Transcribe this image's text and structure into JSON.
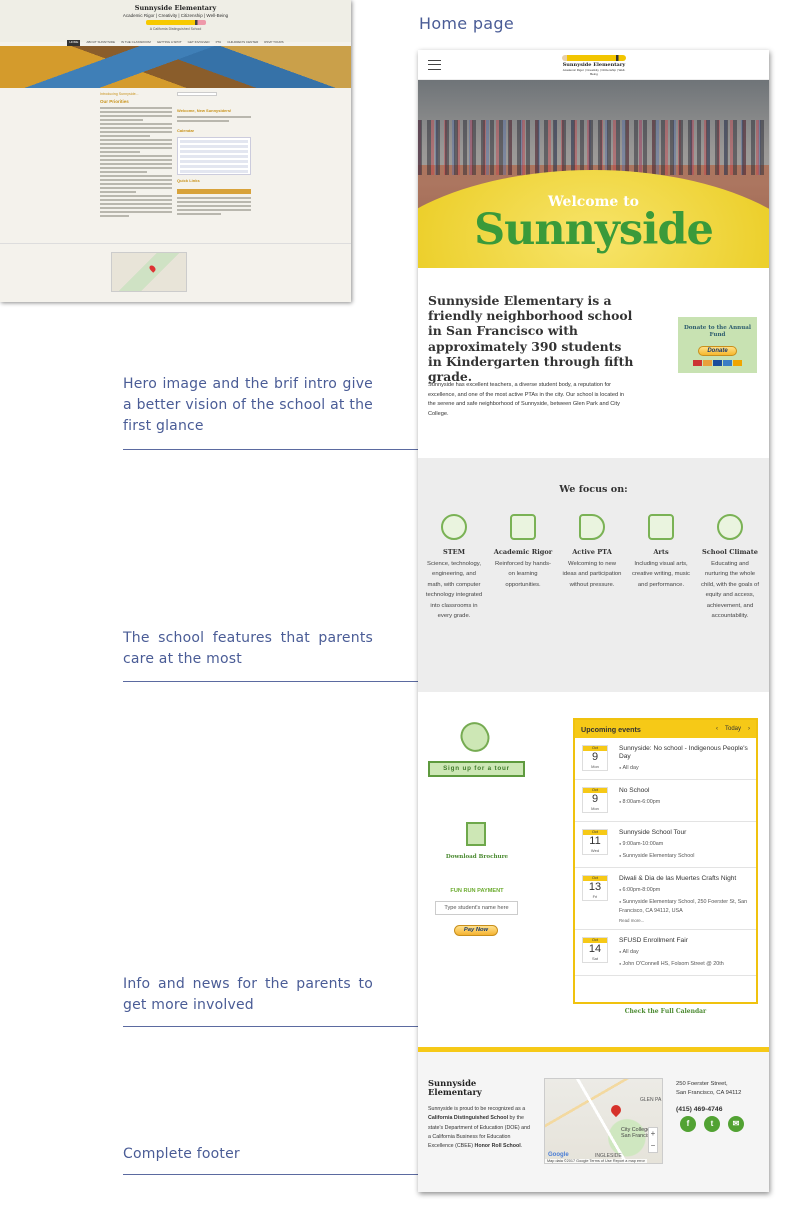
{
  "old_site": {
    "title": "Sunnyside Elementary",
    "tagline": "Academic Rigor | Creativity | Citizenship | Well-Being",
    "subtitle": "A California Distinguished School",
    "nav": [
      "HOME",
      "ABOUT SUNNYSIDE",
      "IN THE CLASSROOM",
      "GETTING A SPOT",
      "GET INVOLVED",
      "PTA",
      "CHILDREN'S CENTER",
      "RSVP TOURS"
    ],
    "intro_label": "Introducing Sunnyside...",
    "priorities_label": "Our Priorities",
    "welcome_label": "Welcome, New Sunnysiders!",
    "calendar_label": "Calendar",
    "quick_links_label": "Quick Links"
  },
  "home_label": "Home page",
  "annotations": [
    "Hero image and the brif intro give a better vision of the school at the first glance",
    "The school features that parents care at the most",
    "Info and news for the parents to get more involved",
    "Complete footer"
  ],
  "header": {
    "logo_title": "Sunnyside Elementary",
    "logo_tagline": "Academic Rigor | Creativity | Citizenship | Well-Being"
  },
  "hero": {
    "welcome": "Welcome to",
    "title": "Sunnyside"
  },
  "intro": {
    "heading": "Sunnyside Elementary is a friendly neighborhood school in San Francisco with approximately 390 students in Kindergarten through fifth grade.",
    "text": "Sunnyside has excellent teachers, a diverse student body, a reputation for excellence, and one of the most active PTAs in the city. Our school is located in the serene and safe neighborhood of Sunnyside, between Glen Park and City College.",
    "donate_title": "Donate to the Annual Fund",
    "donate_button": "Donate"
  },
  "focus": {
    "title": "We focus on:",
    "items": [
      {
        "name": "STEM",
        "desc": "Science, technology, engineering, and math, with computer technology integrated into classrooms in every grade."
      },
      {
        "name": "Academic Rigor",
        "desc": "Reinforced by hands-on learning opportunities."
      },
      {
        "name": "Active PTA",
        "desc": "Welcoming to new ideas and participation without pressure."
      },
      {
        "name": "Arts",
        "desc": "Including visual arts, creative writing, music and performance."
      },
      {
        "name": "School Climate",
        "desc": "Educating and nurturing the whole child, with the goals of equity and access, achievement, and accountability."
      }
    ]
  },
  "info": {
    "tour_button": "Sign up for a tour",
    "brochure": "Download Brochure",
    "fun_run": "FUN RUN PAYMENT",
    "fun_run_placeholder": "Type student's name here",
    "pay_now": "Pay Now",
    "events_title": "Upcoming events",
    "today": "Today",
    "full_calendar": "Check the Full Calendar",
    "events": [
      {
        "month": "Oct",
        "day": "9",
        "weekday": "Mon",
        "title": "Sunnyside: No school - Indigenous People's Day",
        "time": "All day",
        "place": "",
        "more": ""
      },
      {
        "month": "Oct",
        "day": "9",
        "weekday": "Mon",
        "title": "No School",
        "time": "8:00am-6:00pm",
        "place": "",
        "more": ""
      },
      {
        "month": "Oct",
        "day": "11",
        "weekday": "Wed",
        "title": "Sunnyside School Tour",
        "time": "9:00am-10:00am",
        "place": "Sunnyside Elementary School",
        "more": ""
      },
      {
        "month": "Oct",
        "day": "13",
        "weekday": "Fri",
        "title": "Diwali & Dia de las Muertes Crafts Night",
        "time": "6:00pm-8:00pm",
        "place": "Sunnyside Elementary School, 250 Foerster St, San Francisco, CA 94112, USA",
        "more": "Read more..."
      },
      {
        "month": "Oct",
        "day": "14",
        "weekday": "Sat",
        "title": "SFUSD Enrollment Fair",
        "time": "All day",
        "place": "John O'Connell HS, Folsom Street @ 20th",
        "more": ""
      }
    ]
  },
  "footer": {
    "name": "Sunnyside Elementary",
    "text_pre": "Sunnyside is proud to be recognized as a ",
    "text_strong1": "California Distinguished School",
    "text_mid": " by the state's Department of Education (DOE) and a California Business for Education Excellence (CBEE) ",
    "text_strong2": "Honor Roll School",
    "text_end": ".",
    "address1": "250 Foerster Street,",
    "address2": "San Francisco, CA 94112",
    "phone": "(415) 469-4746",
    "map_label_city": "City College of San Francisco",
    "map_label_glen": "GLEN PA",
    "map_label_ingleside": "INGLESIDE",
    "map_footer": "Map data ©2017 Google   Terms of Use   Report a map error",
    "map_google": "Google",
    "social": [
      "f",
      "t",
      "✉"
    ]
  },
  "colors": {
    "accent_green": "#52a233",
    "accent_yellow": "#f6c917",
    "annotation_blue": "#4a5c96"
  }
}
